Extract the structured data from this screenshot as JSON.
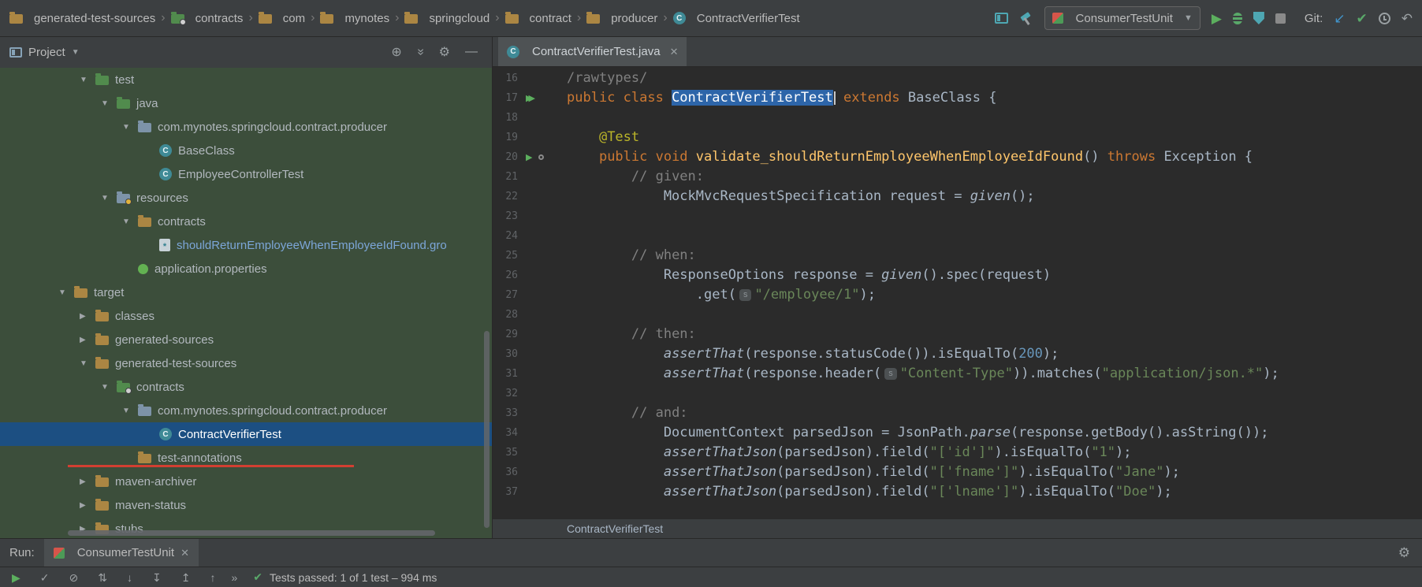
{
  "colors": {
    "accent_blue": "#2d65a9",
    "selection_blue": "#1c4f82",
    "coverage_green": "#3c4e3b",
    "error_red": "#d23f31",
    "run_green": "#5caf5e"
  },
  "breadcrumbs": {
    "items": [
      {
        "icon": "folder-tan",
        "label": "generated-test-sources"
      },
      {
        "icon": "folder-green-badge",
        "label": "contracts"
      },
      {
        "icon": "folder-tan",
        "label": "com"
      },
      {
        "icon": "folder-tan",
        "label": "mynotes"
      },
      {
        "icon": "folder-tan",
        "label": "springcloud"
      },
      {
        "icon": "folder-tan",
        "label": "contract"
      },
      {
        "icon": "folder-tan",
        "label": "producer"
      },
      {
        "icon": "class",
        "label": "ContractVerifierTest"
      }
    ]
  },
  "toolbar": {
    "run_config_label": "ConsumerTestUnit",
    "git_label": "Git:"
  },
  "project_panel": {
    "title": "Project",
    "tree": [
      {
        "level": 2,
        "arrow": "down",
        "icon": "folder-green",
        "label": "test",
        "bg": "green"
      },
      {
        "level": 3,
        "arrow": "down",
        "icon": "folder-green",
        "label": "java",
        "bg": "green"
      },
      {
        "level": 4,
        "arrow": "down",
        "icon": "folder-package",
        "label": "com.mynotes.springcloud.contract.producer",
        "bg": "green"
      },
      {
        "level": 5,
        "arrow": "",
        "icon": "class",
        "label": "BaseClass",
        "bg": "green"
      },
      {
        "level": 5,
        "arrow": "",
        "icon": "class",
        "label": "EmployeeControllerTest",
        "bg": "green"
      },
      {
        "level": 3,
        "arrow": "down",
        "icon": "folder-resources",
        "label": "resources",
        "bg": "green"
      },
      {
        "level": 4,
        "arrow": "down",
        "icon": "folder-tan",
        "label": "contracts",
        "bg": "green"
      },
      {
        "level": 5,
        "arrow": "",
        "icon": "groovy",
        "label": "shouldReturnEmployeeWhenEmployeeIdFound.gro",
        "bg": "green",
        "color": "#7ca6d8"
      },
      {
        "level": 4,
        "arrow": "",
        "icon": "spring",
        "label": "application.properties",
        "bg": "green"
      },
      {
        "level": 1,
        "arrow": "down",
        "icon": "folder-tan",
        "label": "target",
        "bg": "green"
      },
      {
        "level": 2,
        "arrow": "right",
        "icon": "folder-tan",
        "label": "classes",
        "bg": "green"
      },
      {
        "level": 2,
        "arrow": "right",
        "icon": "folder-tan",
        "label": "generated-sources",
        "bg": "green"
      },
      {
        "level": 2,
        "arrow": "down",
        "icon": "folder-tan",
        "label": "generated-test-sources",
        "bg": "green"
      },
      {
        "level": 3,
        "arrow": "down",
        "icon": "folder-green-badge",
        "label": "contracts",
        "bg": "green"
      },
      {
        "level": 4,
        "arrow": "down",
        "icon": "folder-package",
        "label": "com.mynotes.springcloud.contract.producer",
        "bg": "green"
      },
      {
        "level": 5,
        "arrow": "",
        "icon": "class",
        "label": "ContractVerifierTest",
        "bg": "selected",
        "color": "#ffffff"
      },
      {
        "level": 4,
        "arrow": "",
        "icon": "folder-tan",
        "label": "test-annotations",
        "bg": "green"
      },
      {
        "level": 2,
        "arrow": "right",
        "icon": "folder-tan",
        "label": "maven-archiver",
        "bg": "green"
      },
      {
        "level": 2,
        "arrow": "right",
        "icon": "folder-tan",
        "label": "maven-status",
        "bg": "green"
      },
      {
        "level": 2,
        "arrow": "right",
        "icon": "folder-tan",
        "label": "stubs",
        "bg": "green"
      }
    ]
  },
  "editor": {
    "tab_label": "ContractVerifierTest.java",
    "breadcrumb": "ContractVerifierTest",
    "code": {
      "lines": [
        {
          "n": "16",
          "g": null,
          "t": [
            [
              "c",
              "/rawtypes/"
            ]
          ]
        },
        {
          "n": "17",
          "g": "runs",
          "t": [
            [
              "k",
              "public class "
            ],
            [
              "sel",
              "ContractVerifierTest"
            ],
            [
              "caret",
              ""
            ],
            [
              "p",
              " "
            ],
            [
              "k",
              "extends"
            ],
            [
              "p",
              " BaseClass {"
            ]
          ]
        },
        {
          "n": "18",
          "g": null,
          "t": []
        },
        {
          "n": "19",
          "g": null,
          "t": [
            [
              "p",
              "    "
            ],
            [
              "a",
              "@Test"
            ]
          ]
        },
        {
          "n": "20",
          "g": "run",
          "t": [
            [
              "p",
              "    "
            ],
            [
              "k",
              "public void "
            ],
            [
              "m",
              "validate_shouldReturnEmployeeWhenEmployeeIdFound"
            ],
            [
              "p",
              "() "
            ],
            [
              "k",
              "throws"
            ],
            [
              "p",
              " Exception {"
            ]
          ]
        },
        {
          "n": "21",
          "g": null,
          "t": [
            [
              "p",
              "        "
            ],
            [
              "c",
              "// given:"
            ]
          ]
        },
        {
          "n": "22",
          "g": null,
          "t": [
            [
              "p",
              "            MockMvcRequestSpecification request = "
            ],
            [
              "i",
              "given"
            ],
            [
              "p",
              "();"
            ]
          ]
        },
        {
          "n": "23",
          "g": null,
          "t": []
        },
        {
          "n": "24",
          "g": null,
          "t": []
        },
        {
          "n": "25",
          "g": null,
          "t": [
            [
              "p",
              "        "
            ],
            [
              "c",
              "// when:"
            ]
          ]
        },
        {
          "n": "26",
          "g": null,
          "t": [
            [
              "p",
              "            ResponseOptions response = "
            ],
            [
              "i",
              "given"
            ],
            [
              "p",
              "().spec(request)"
            ]
          ]
        },
        {
          "n": "27",
          "g": null,
          "t": [
            [
              "p",
              "                .get("
            ],
            [
              "inlay",
              "s"
            ],
            [
              "s",
              "\"/employee/1\""
            ],
            [
              "p",
              ");"
            ]
          ]
        },
        {
          "n": "28",
          "g": null,
          "t": []
        },
        {
          "n": "29",
          "g": null,
          "t": [
            [
              "p",
              "        "
            ],
            [
              "c",
              "// then:"
            ]
          ]
        },
        {
          "n": "30",
          "g": null,
          "t": [
            [
              "p",
              "            "
            ],
            [
              "i",
              "assertThat"
            ],
            [
              "p",
              "(response.statusCode()).isEqualTo("
            ],
            [
              "n2",
              "200"
            ],
            [
              "p",
              ");"
            ]
          ]
        },
        {
          "n": "31",
          "g": null,
          "t": [
            [
              "p",
              "            "
            ],
            [
              "i",
              "assertThat"
            ],
            [
              "p",
              "(response.header("
            ],
            [
              "inlay",
              "s"
            ],
            [
              "s",
              "\"Content-Type\""
            ],
            [
              "p",
              ")).matches("
            ],
            [
              "s",
              "\"application/json.*\""
            ],
            [
              "p",
              ");"
            ]
          ]
        },
        {
          "n": "32",
          "g": null,
          "t": []
        },
        {
          "n": "33",
          "g": null,
          "t": [
            [
              "p",
              "        "
            ],
            [
              "c",
              "// and:"
            ]
          ]
        },
        {
          "n": "34",
          "g": null,
          "t": [
            [
              "p",
              "            DocumentContext parsedJson = JsonPath."
            ],
            [
              "i",
              "parse"
            ],
            [
              "p",
              "(response.getBody().asString());"
            ]
          ]
        },
        {
          "n": "35",
          "g": null,
          "t": [
            [
              "p",
              "            "
            ],
            [
              "i",
              "assertThatJson"
            ],
            [
              "p",
              "(parsedJson).field("
            ],
            [
              "s",
              "\"['id']\""
            ],
            [
              "p",
              ").isEqualTo("
            ],
            [
              "s",
              "\"1\""
            ],
            [
              "p",
              ");"
            ]
          ]
        },
        {
          "n": "36",
          "g": null,
          "t": [
            [
              "p",
              "            "
            ],
            [
              "i",
              "assertThatJson"
            ],
            [
              "p",
              "(parsedJson).field("
            ],
            [
              "s",
              "\"['fname']\""
            ],
            [
              "p",
              ").isEqualTo("
            ],
            [
              "s",
              "\"Jane\""
            ],
            [
              "p",
              ");"
            ]
          ]
        },
        {
          "n": "37",
          "g": null,
          "t": [
            [
              "p",
              "            "
            ],
            [
              "i",
              "assertThatJson"
            ],
            [
              "p",
              "(parsedJson).field("
            ],
            [
              "s",
              "\"['lname']\""
            ],
            [
              "p",
              ").isEqualTo("
            ],
            [
              "s",
              "\"Doe\""
            ],
            [
              "p",
              ");"
            ]
          ]
        }
      ]
    }
  },
  "run_panel": {
    "label": "Run:",
    "tab_label": "ConsumerTestUnit",
    "status": "Tests passed: 1 of 1 test – 994 ms",
    "toolbar_icons": [
      {
        "name": "rerun-tests",
        "glyph": "▶",
        "color": "green"
      },
      {
        "name": "toggle-auto-test",
        "glyph": "✓",
        "color": "gray"
      },
      {
        "name": "hide-passed",
        "glyph": "⊘",
        "color": "gray"
      },
      {
        "name": "sort-alphabetically",
        "glyph": "⇅",
        "color": "gray"
      },
      {
        "name": "sort-by-duration",
        "glyph": "↓",
        "color": "gray"
      },
      {
        "name": "expand-all",
        "glyph": "↧",
        "color": "gray"
      },
      {
        "name": "collapse-all",
        "glyph": "↥",
        "color": "gray"
      },
      {
        "name": "previous-failed-test",
        "glyph": "↑",
        "color": "gray"
      }
    ],
    "more_glyph": "»"
  }
}
